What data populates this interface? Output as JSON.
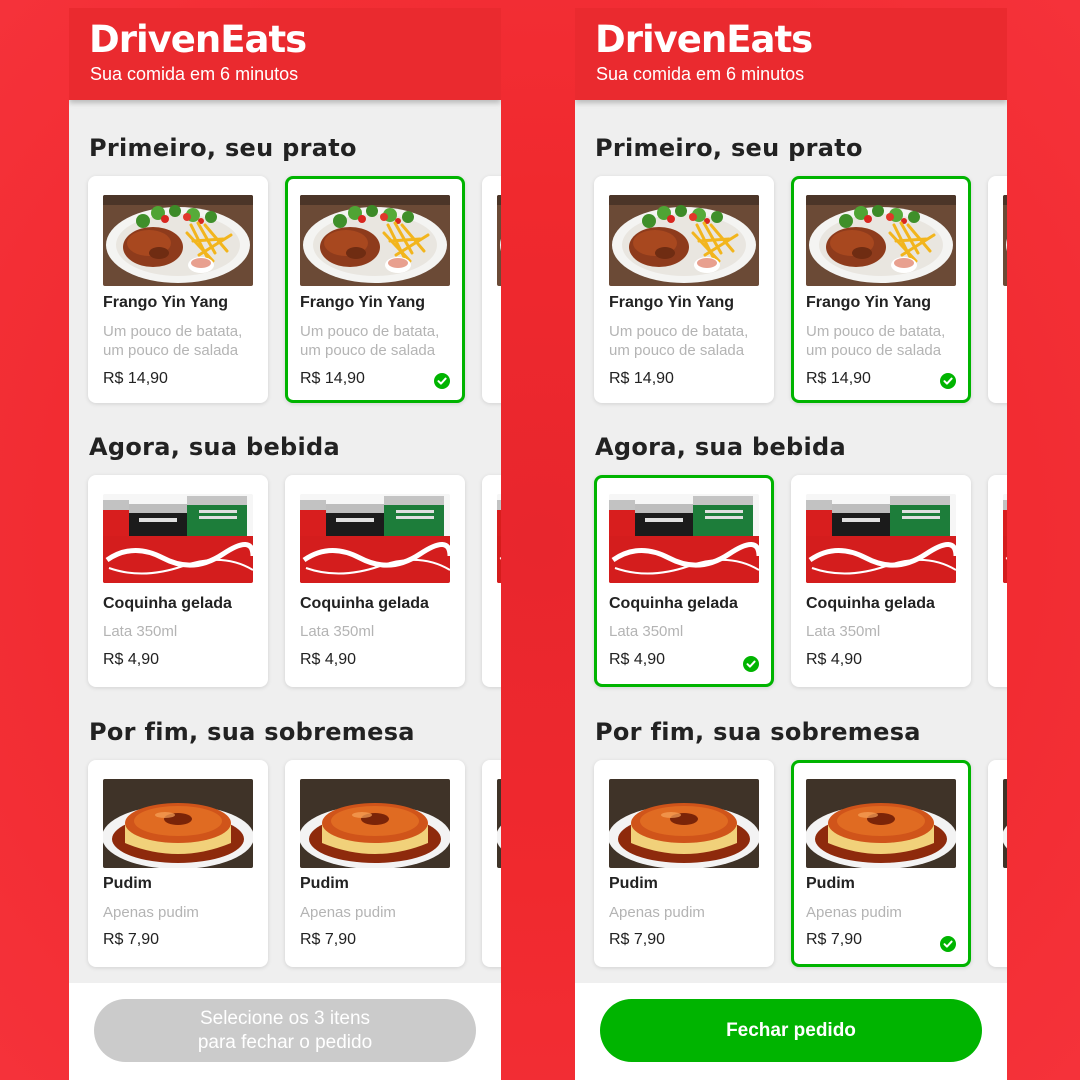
{
  "brand": {
    "logo": "DrivenEats",
    "tagline": "Sua comida em 6 minutos"
  },
  "sections": {
    "dish": {
      "title": "Primeiro, seu prato"
    },
    "drink": {
      "title": "Agora, sua bebida"
    },
    "dessert": {
      "title": "Por fim, sua sobremesa"
    }
  },
  "items": {
    "dish": {
      "name": "Frango Yin Yang",
      "description": "Um pouco de batata, um pouco de salada",
      "price": "R$ 14,90",
      "image": "frango-yin-yang-photo"
    },
    "drink": {
      "name": "Coquinha gelada",
      "description": "Lata 350ml",
      "price": "R$ 4,90",
      "image": "coca-cola-cans-photo"
    },
    "dessert": {
      "name": "Pudim",
      "description": "Apenas pudim",
      "price": "R$ 7,90",
      "image": "pudim-photo"
    }
  },
  "screens": {
    "left": {
      "state": "incomplete",
      "selected": {
        "dish": 2,
        "drink": null,
        "dessert": null
      },
      "button": {
        "label_line1": "Selecione os 3 itens",
        "label_line2": "para fechar o pedido"
      }
    },
    "right": {
      "state": "complete",
      "selected": {
        "dish": 2,
        "drink": 1,
        "dessert": 2
      },
      "button": {
        "label": "Fechar pedido"
      }
    }
  },
  "colors": {
    "brand_red": "#ea2a2f",
    "selected_green": "#00b400",
    "disabled_gray": "#cbcbcb",
    "page_background": "#efefef"
  },
  "icons": {
    "selected_check": "check-circle-icon"
  }
}
